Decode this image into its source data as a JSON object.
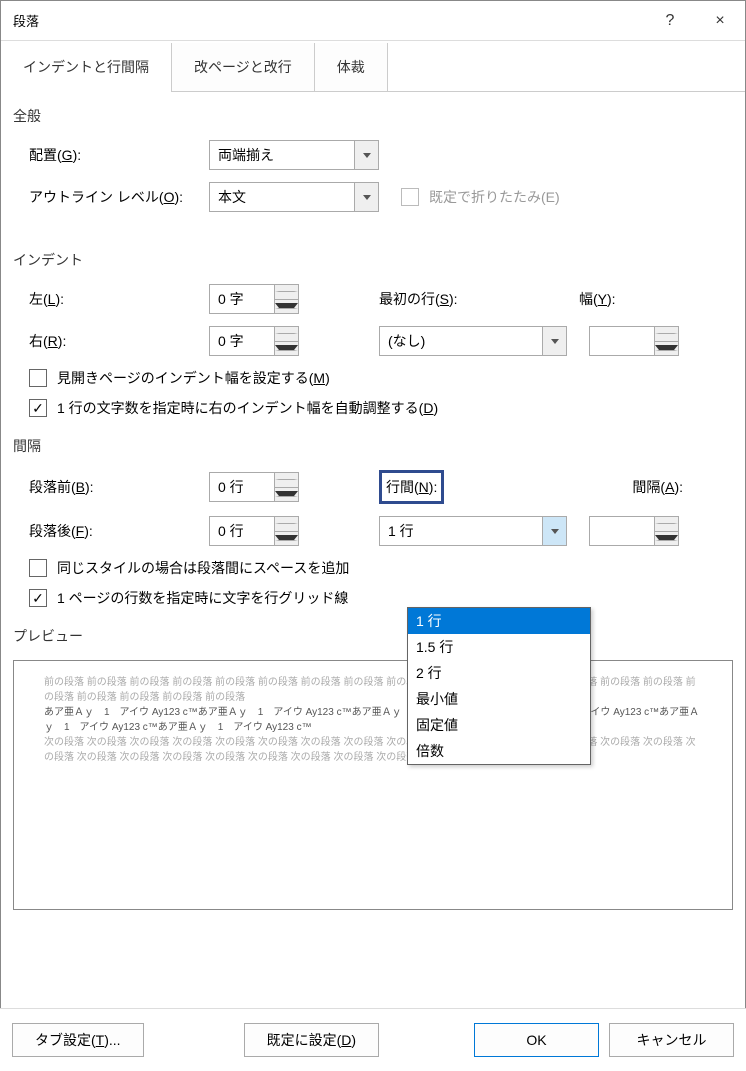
{
  "titlebar": {
    "title": "段落",
    "help": "?",
    "close": "×"
  },
  "tabs": {
    "t1": "インデントと行間隔",
    "t2": "改ページと改行",
    "t3": "体裁"
  },
  "general": {
    "title": "全般",
    "alignment_label": "配置(G):",
    "alignment_value": "両端揃え",
    "outline_label": "アウトライン レベル(O):",
    "outline_value": "本文",
    "collapse_label": "既定で折りたたみ(E)",
    "g_key": "G",
    "o_key": "O"
  },
  "indent": {
    "title": "インデント",
    "left_label": "左(L):",
    "left_value": "0 字",
    "right_label": "右(R):",
    "right_value": "0 字",
    "firstline_label": "最初の行(S):",
    "firstline_value": "(なし)",
    "width_label": "幅(Y):",
    "mirror_label": "見開きページのインデント幅を設定する(M)",
    "auto_label": "1 行の文字数を指定時に右のインデント幅を自動調整する(D)",
    "l_key": "L",
    "r_key": "R",
    "s_key": "S",
    "y_key": "Y",
    "m_key": "M",
    "d_key": "D"
  },
  "spacing": {
    "title": "間隔",
    "before_label": "段落前(B):",
    "before_value": "0 行",
    "after_label": "段落後(F):",
    "after_value": "0 行",
    "line_label_pre": "行間(",
    "line_label_key": "N",
    "line_label_post": "):",
    "line_value": "1 行",
    "at_label": "間隔(A):",
    "nospace_label": "同じスタイルの場合は段落間にスペースを追加",
    "snap_label": "1 ページの行数を指定時に文字を行グリッド線",
    "b_key": "B",
    "f_key": "F",
    "a_key": "A",
    "options": [
      "1 行",
      "1.5 行",
      "2 行",
      "最小値",
      "固定値",
      "倍数"
    ]
  },
  "preview": {
    "title": "プレビュー",
    "prev_para": "前の段落 前の段落 前の段落 前の段落 前の段落 前の段落 前の段落 前の段落 前の段落 前の段落 前の段落 前の段落 前の段落 前の段落 前の段落 前の段落 前の段落 前の段落 前の段落 前の段落",
    "sample": "あア亜Ａｙ　1　アイウ Ay123 c™あア亜Ａｙ　1　アイウ Ay123 c™あア亜Ａｙ　1　アイウ Ay123 c™あア亜Ａｙ　1　アイウ Ay123 c™あア亜Ａｙ　1　アイウ Ay123 c™あア亜Ａｙ　1　アイウ Ay123 c™",
    "next_para": "次の段落 次の段落 次の段落 次の段落 次の段落 次の段落 次の段落 次の段落 次の段落 次の段落 次の段落 次の段落 次の段落 次の段落 次の段落 次の段落 次の段落 次の段落 次の段落 次の段落 次の段落 次の段落 次の段落 次の段落 次の段落 次の段落 次の段落"
  },
  "footer": {
    "tabs": "タブ設定(T)...",
    "default": "既定に設定(D)",
    "ok": "OK",
    "cancel": "キャンセル",
    "t_key": "T",
    "d_key": "D"
  }
}
